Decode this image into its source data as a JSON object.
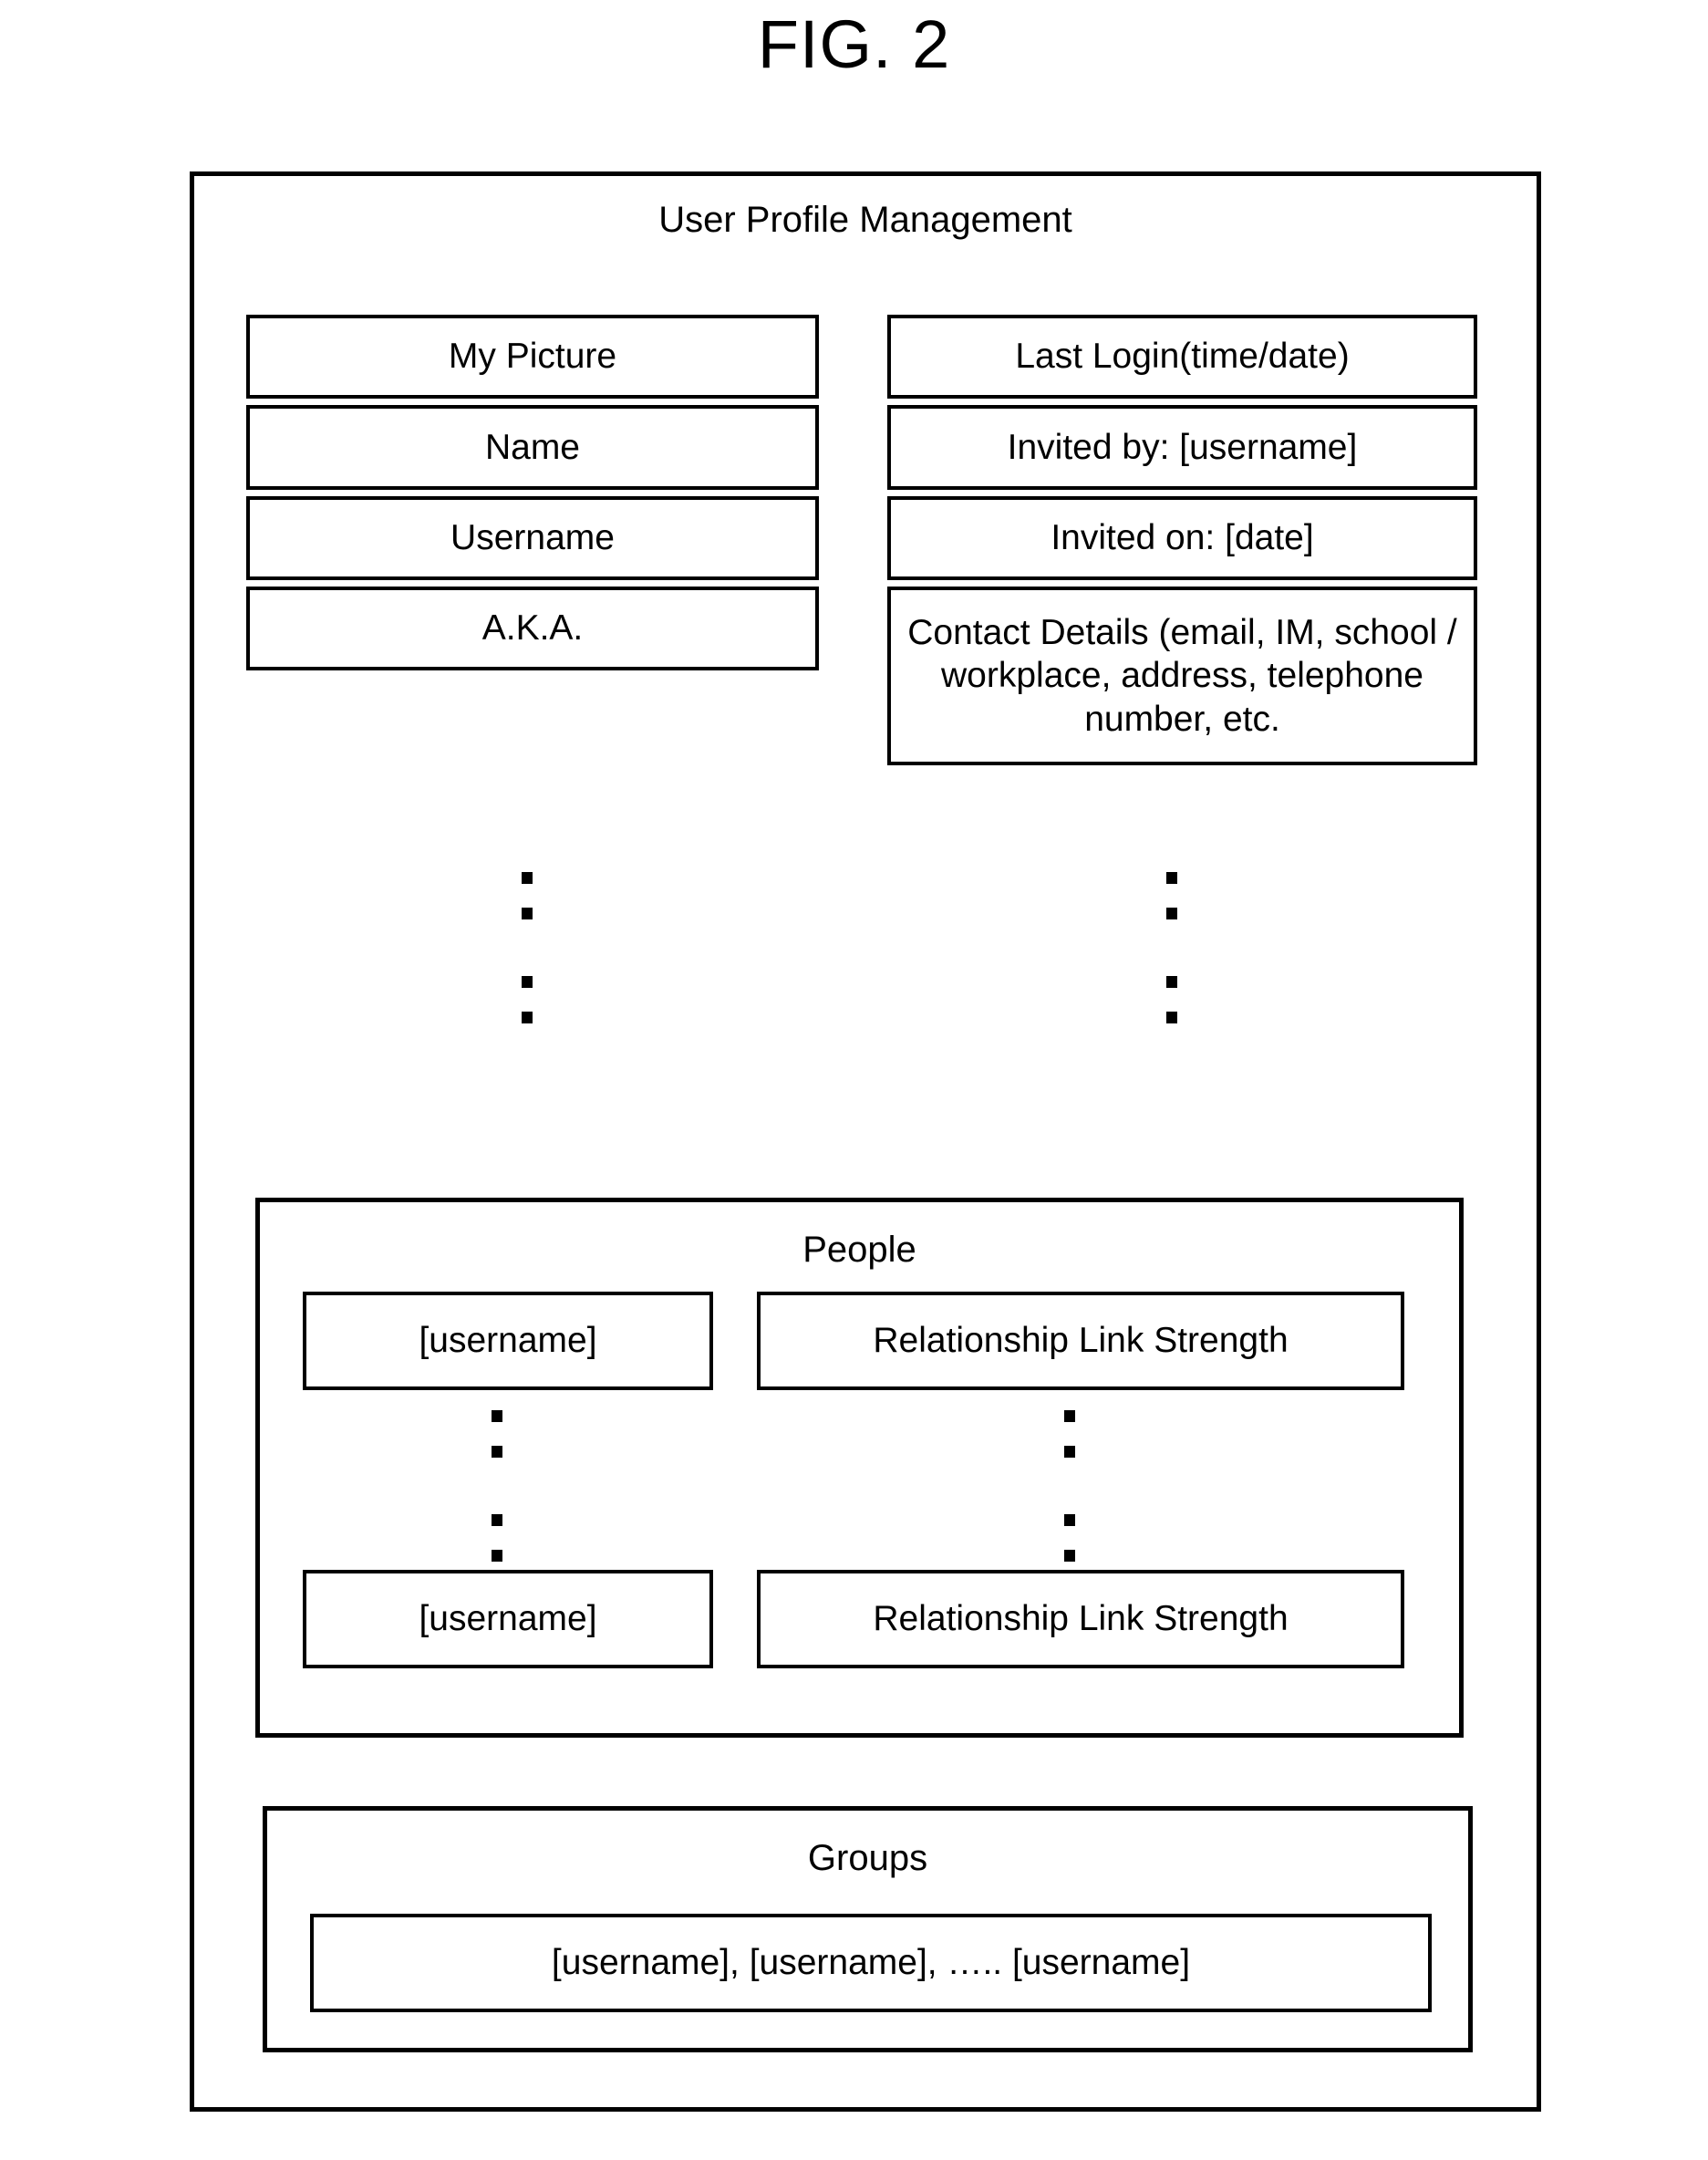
{
  "figure": {
    "label": "FIG. 2"
  },
  "panel": {
    "title": "User Profile Management"
  },
  "profile_fields": {
    "left_column": [
      {
        "label": "My Picture"
      },
      {
        "label": "Name"
      },
      {
        "label": "Username"
      },
      {
        "label": "A.K.A."
      }
    ],
    "right_column": [
      {
        "label": "Last Login(time/date)"
      },
      {
        "label": "Invited by: [username]"
      },
      {
        "label": "Invited on: [date]"
      },
      {
        "label": "Contact Details (email, IM, school / workplace, address, telephone number, etc."
      }
    ]
  },
  "continuation": {
    "glyph": "vertical-ellipsis",
    "dot_count": 4
  },
  "people_section": {
    "title": "People",
    "rows": [
      {
        "name": "[username]",
        "strength": "Relationship Link Strength"
      },
      {
        "name": "[username]",
        "strength": "Relationship Link Strength"
      }
    ]
  },
  "groups_section": {
    "title": "Groups",
    "members": "[username], [username], …..  [username]"
  }
}
